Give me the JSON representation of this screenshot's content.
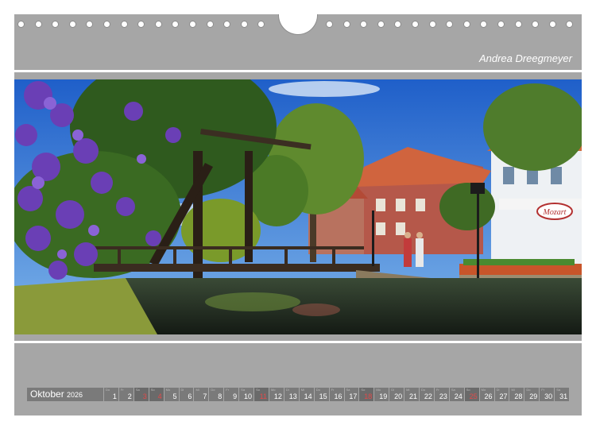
{
  "author": "Andrea Dreegmeyer",
  "calendar": {
    "month": "Oktober",
    "year": "2026",
    "days": [
      {
        "d": "1",
        "w": "Do",
        "we": false
      },
      {
        "d": "2",
        "w": "Fr",
        "we": false
      },
      {
        "d": "3",
        "w": "Sa",
        "we": true
      },
      {
        "d": "4",
        "w": "So",
        "we": true
      },
      {
        "d": "5",
        "w": "Mo",
        "we": false
      },
      {
        "d": "6",
        "w": "Di",
        "we": false
      },
      {
        "d": "7",
        "w": "Mi",
        "we": false
      },
      {
        "d": "8",
        "w": "Do",
        "we": false
      },
      {
        "d": "9",
        "w": "Fr",
        "we": false
      },
      {
        "d": "10",
        "w": "Sa",
        "we": false
      },
      {
        "d": "11",
        "w": "So",
        "we": true
      },
      {
        "d": "12",
        "w": "Mo",
        "we": false
      },
      {
        "d": "13",
        "w": "Di",
        "we": false
      },
      {
        "d": "14",
        "w": "Mi",
        "we": false
      },
      {
        "d": "15",
        "w": "Do",
        "we": false
      },
      {
        "d": "16",
        "w": "Fr",
        "we": false
      },
      {
        "d": "17",
        "w": "Sa",
        "we": false
      },
      {
        "d": "18",
        "w": "So",
        "we": true
      },
      {
        "d": "19",
        "w": "Mo",
        "we": false
      },
      {
        "d": "20",
        "w": "Di",
        "we": false
      },
      {
        "d": "21",
        "w": "Mi",
        "we": false
      },
      {
        "d": "22",
        "w": "Do",
        "we": false
      },
      {
        "d": "23",
        "w": "Fr",
        "we": false
      },
      {
        "d": "24",
        "w": "Sa",
        "we": false
      },
      {
        "d": "25",
        "w": "So",
        "we": true
      },
      {
        "d": "26",
        "w": "Mo",
        "we": false
      },
      {
        "d": "27",
        "w": "Di",
        "we": false
      },
      {
        "d": "28",
        "w": "Mi",
        "we": false
      },
      {
        "d": "29",
        "w": "Do",
        "we": false
      },
      {
        "d": "30",
        "w": "Fr",
        "we": false
      },
      {
        "d": "31",
        "w": "Sa",
        "we": false
      }
    ]
  },
  "photo": {
    "sign_text": "Mozart"
  },
  "colors": {
    "page_bg": "#a6a6a6",
    "cell_bg": "#7a7a7a",
    "weekend_text": "#e24a4a"
  }
}
